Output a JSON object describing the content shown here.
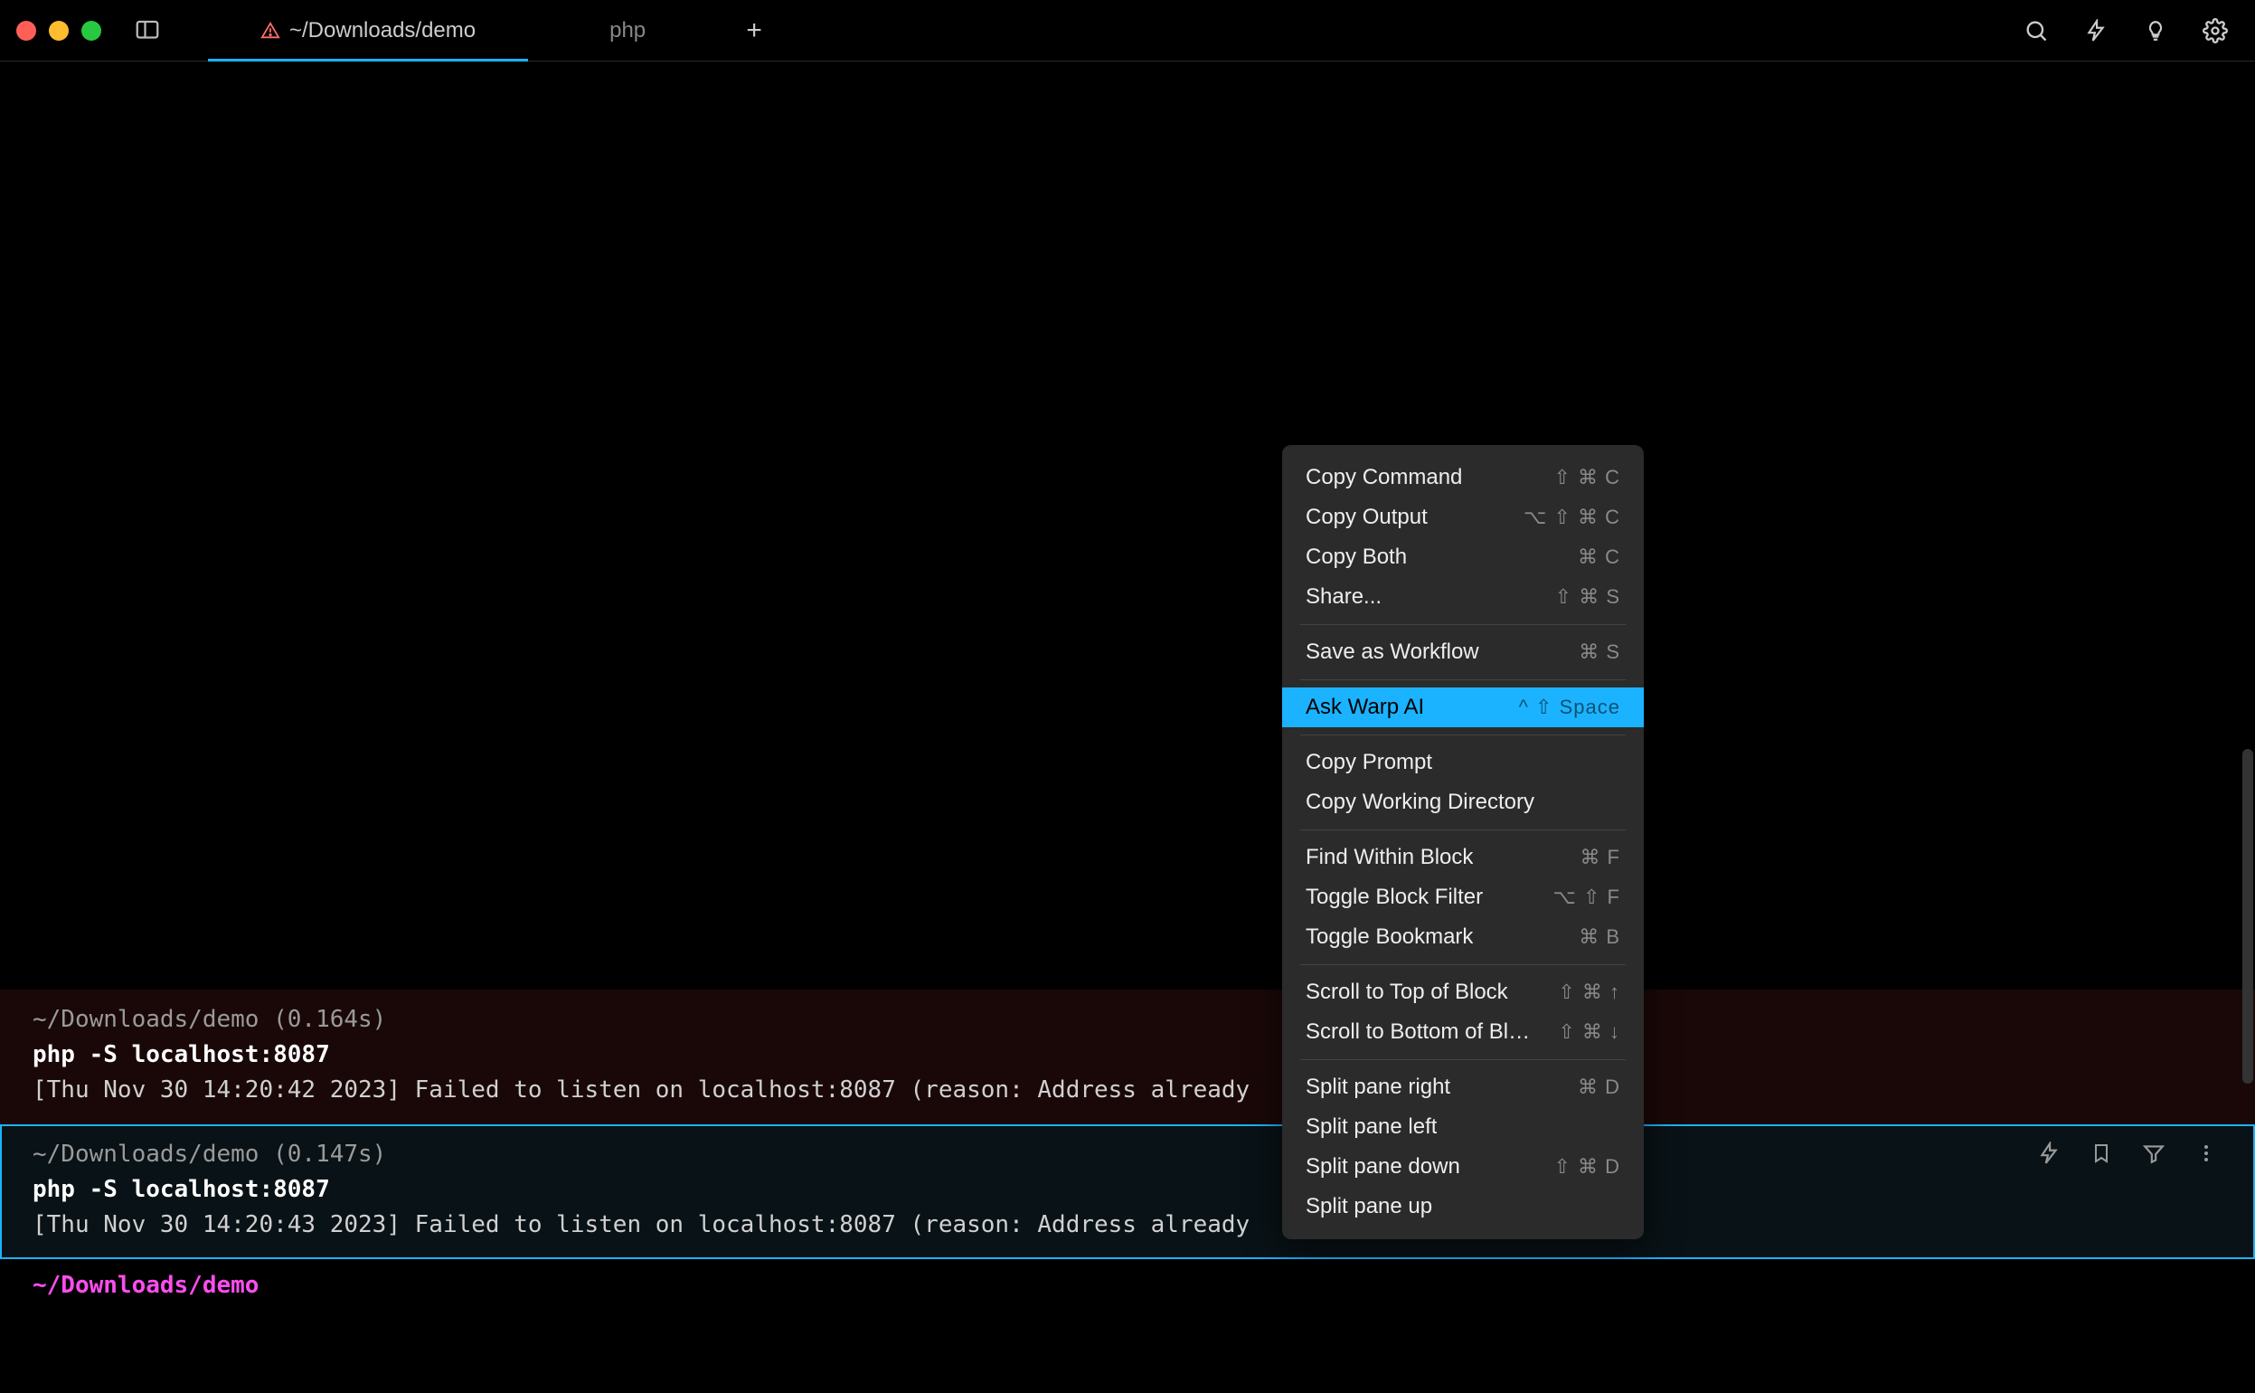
{
  "titlebar": {
    "tabs": [
      {
        "label": "~/Downloads/demo",
        "has_warning": true,
        "active": true
      },
      {
        "label": "php",
        "has_warning": false,
        "active": false
      }
    ]
  },
  "blocks": [
    {
      "status": "error",
      "selected": false,
      "prompt_path": "~/Downloads/demo",
      "duration": "(0.164s)",
      "command": "php -S localhost:8087",
      "output": "[Thu Nov 30 14:20:42 2023] Failed to listen on localhost:8087 (reason: Address already"
    },
    {
      "status": "error",
      "selected": true,
      "prompt_path": "~/Downloads/demo",
      "duration": "(0.147s)",
      "command": "php -S localhost:8087",
      "output": "[Thu Nov 30 14:20:43 2023] Failed to listen on localhost:8087 (reason: Address already"
    }
  ],
  "prompt": {
    "cwd": "~/Downloads/demo"
  },
  "context_menu": {
    "groups": [
      [
        {
          "label": "Copy Command",
          "shortcut": "⇧ ⌘ C",
          "highlight": false
        },
        {
          "label": "Copy Output",
          "shortcut": "⌥ ⇧ ⌘ C",
          "highlight": false
        },
        {
          "label": "Copy Both",
          "shortcut": "⌘ C",
          "highlight": false
        },
        {
          "label": "Share...",
          "shortcut": "⇧ ⌘ S",
          "highlight": false
        }
      ],
      [
        {
          "label": "Save as Workflow",
          "shortcut": "⌘ S",
          "highlight": false
        }
      ],
      [
        {
          "label": "Ask Warp AI",
          "shortcut": "^ ⇧ Space",
          "highlight": true
        }
      ],
      [
        {
          "label": "Copy Prompt",
          "shortcut": "",
          "highlight": false
        },
        {
          "label": "Copy Working Directory",
          "shortcut": "",
          "highlight": false
        }
      ],
      [
        {
          "label": "Find Within Block",
          "shortcut": "⌘ F",
          "highlight": false
        },
        {
          "label": "Toggle Block Filter",
          "shortcut": "⌥ ⇧ F",
          "highlight": false
        },
        {
          "label": "Toggle Bookmark",
          "shortcut": "⌘ B",
          "highlight": false
        }
      ],
      [
        {
          "label": "Scroll to Top of Block",
          "shortcut": "⇧ ⌘ ↑",
          "highlight": false
        },
        {
          "label": "Scroll to Bottom of Block",
          "shortcut": "⇧ ⌘ ↓",
          "highlight": false
        }
      ],
      [
        {
          "label": "Split pane right",
          "shortcut": "⌘ D",
          "highlight": false
        },
        {
          "label": "Split pane left",
          "shortcut": "",
          "highlight": false
        },
        {
          "label": "Split pane down",
          "shortcut": "⇧ ⌘ D",
          "highlight": false
        },
        {
          "label": "Split pane up",
          "shortcut": "",
          "highlight": false
        }
      ]
    ]
  }
}
